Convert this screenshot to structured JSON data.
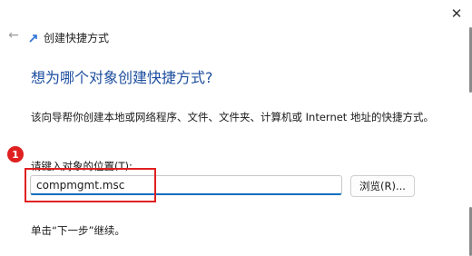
{
  "window": {
    "close_glyph": "✕"
  },
  "nav": {
    "back_glyph": "←",
    "icon": "shortcut-arrow-icon"
  },
  "wizard": {
    "title": "创建快捷方式",
    "heading": "想为哪个对象创建快捷方式?",
    "description": "该向导帮你创建本地或网络程序、文件、文件夹、计算机或 Internet 地址的快捷方式。",
    "field_label": "请键入对象的位置(T):",
    "location_value": "compmgmt.msc",
    "browse_label": "浏览(R)...",
    "next_hint": "单击“下一步”继续。"
  },
  "annotation": {
    "step_number": "1",
    "color": "#e02020"
  },
  "colors": {
    "heading": "#1d4e9e",
    "input_accent": "#0f6cbd"
  }
}
